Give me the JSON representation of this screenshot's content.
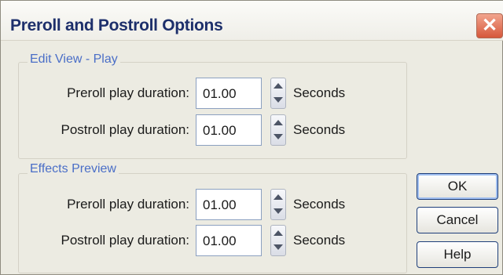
{
  "dialog": {
    "title": "Preroll and Postroll Options",
    "close_glyph": "✕"
  },
  "edit_view": {
    "label": "Edit View - Play",
    "preroll_label": "Preroll play duration:",
    "preroll_value": "01.00",
    "postroll_label": "Postroll play duration:",
    "postroll_value": "01.00",
    "unit": "Seconds"
  },
  "effects_preview": {
    "label": "Effects Preview",
    "preroll_label": "Preroll play duration:",
    "preroll_value": "01.00",
    "postroll_label": "Postroll play duration:",
    "postroll_value": "01.00",
    "unit": "Seconds"
  },
  "buttons": {
    "ok": "OK",
    "cancel": "Cancel",
    "help": "Help"
  },
  "colors": {
    "title_text": "#1d2f6b",
    "group_label": "#4a6ec7",
    "close_button": "#d6573b"
  }
}
